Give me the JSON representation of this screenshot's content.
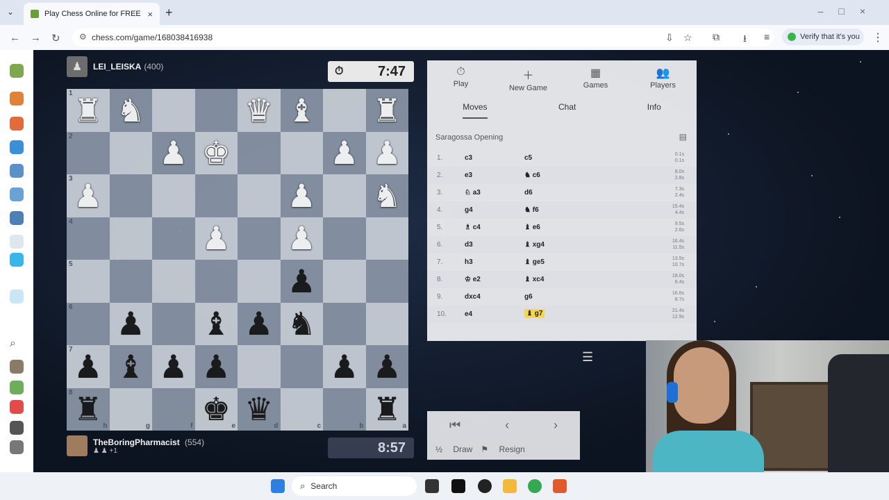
{
  "browser": {
    "tab_title": "Play Chess Online for FREE",
    "url": "chess.com/game/168038416938",
    "verify": "Verify that it's you"
  },
  "top_player": {
    "name": "LEI_LEISKA",
    "rating": "(400)",
    "clock": "7:47"
  },
  "bottom_player": {
    "name": "TheBoringPharmacist",
    "rating": "(554)",
    "clock": "8:57",
    "extra": "+1"
  },
  "board": {
    "rows": [
      [
        "wR",
        "wN",
        "",
        "",
        "wQ",
        "wB",
        "",
        "wR"
      ],
      [
        "",
        "",
        "wP",
        "wK",
        "",
        "",
        "wP",
        "wP"
      ],
      [
        "wP",
        "",
        "",
        "",
        "",
        "wP",
        "",
        "wN"
      ],
      [
        "",
        "",
        "",
        "wP",
        "",
        "wP",
        "",
        ""
      ],
      [
        "",
        "",
        "",
        "",
        "",
        "bP",
        "",
        ""
      ],
      [
        "",
        "bP",
        "",
        "bB",
        "bP",
        "bN",
        "",
        ""
      ],
      [
        "bP",
        "bB",
        "bP",
        "bP",
        "",
        "",
        "bP",
        "bP"
      ],
      [
        "bR",
        "",
        "",
        "bK",
        "bQ",
        "",
        "",
        "bR"
      ]
    ],
    "rank_labels": [
      "1",
      "2",
      "3",
      "4",
      "5",
      "6",
      "7",
      "8"
    ],
    "file_labels": [
      "h",
      "g",
      "f",
      "e",
      "d",
      "c",
      "b",
      "a"
    ]
  },
  "panel": {
    "tabs": [
      {
        "label": "Play",
        "icon": "stopwatch-icon"
      },
      {
        "label": "New Game",
        "icon": "plus-icon"
      },
      {
        "label": "Games",
        "icon": "board-icon"
      },
      {
        "label": "Players",
        "icon": "people-icon"
      }
    ],
    "subtabs": [
      "Moves",
      "Chat",
      "Info"
    ],
    "opening": "Saragossa Opening",
    "moves": [
      {
        "n": "1.",
        "w": "c3",
        "b": "c5",
        "t1": "0.1s",
        "t2": "0.1s"
      },
      {
        "n": "2.",
        "w": "e3",
        "b": "♞ c6",
        "t1": "8.0s",
        "t2": "2.8s"
      },
      {
        "n": "3.",
        "w": "♘ a3",
        "b": "d6",
        "t1": "7.3s",
        "t2": "2.4s"
      },
      {
        "n": "4.",
        "w": "g4",
        "b": "♞ f6",
        "t1": "15.4s",
        "t2": "4.4s"
      },
      {
        "n": "5.",
        "w": "♗ c4",
        "b": "♝ e6",
        "t1": "9.5s",
        "t2": "2.6s"
      },
      {
        "n": "6.",
        "w": "d3",
        "b": "♝ xg4",
        "t1": "16.4s",
        "t2": "11.5s"
      },
      {
        "n": "7.",
        "w": "h3",
        "b": "♝ ge5",
        "t1": "13.5s",
        "t2": "10.7s"
      },
      {
        "n": "8.",
        "w": "♔ e2",
        "b": "♝ xc4",
        "t1": "18.0s",
        "t2": "6.4s"
      },
      {
        "n": "9.",
        "w": "dxc4",
        "b": "g6",
        "t1": "16.6s",
        "t2": "8.7s"
      },
      {
        "n": "10.",
        "w": "e4",
        "b": "♝ g7",
        "t1": "21.4s",
        "t2": "12.9s"
      }
    ],
    "draw": "Draw",
    "resign": "Resign"
  },
  "taskbar": {
    "search": "Search"
  }
}
